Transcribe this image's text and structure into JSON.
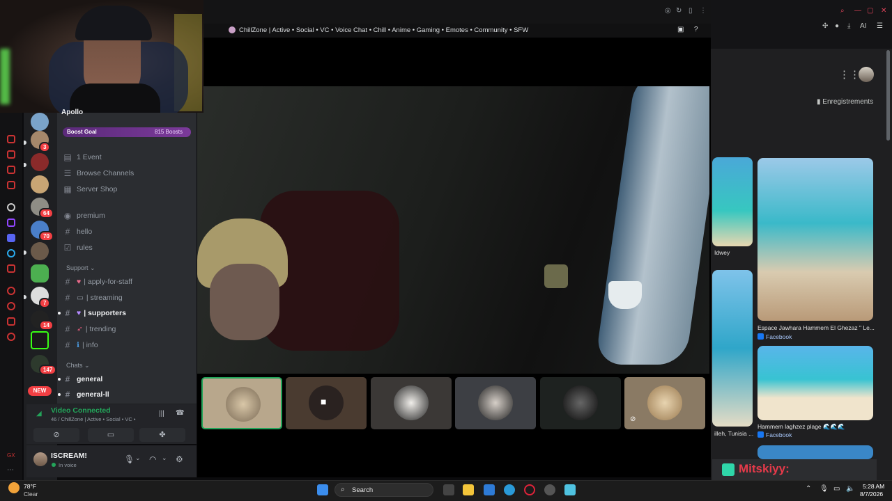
{
  "discord": {
    "boost_goal": {
      "label": "Boost Goal",
      "count": "815 Boosts"
    },
    "server_badges": [
      "3",
      "64",
      "70",
      "7",
      "14",
      "147"
    ],
    "new_badge": "NEW",
    "server_title_partial": "Apollo",
    "channels": {
      "event": "1 Event",
      "browse": "Browse Channels",
      "shop": "Server Shop",
      "premium": "premium",
      "hello": "hello",
      "rules": "rules",
      "support_category": "Support",
      "apply": "| apply-for-staff",
      "streaming": "| streaming",
      "supporters": "| supporters",
      "trending": "| trending",
      "info": "| info",
      "chats_category": "Chats",
      "general": "general",
      "general2": "general-ll"
    },
    "voice": {
      "status": "Video Connected",
      "channel": "46 / ChillZone | Active • Social • VC •"
    },
    "user": {
      "name": "ISCREAM!",
      "status": "In voice"
    },
    "call_title": "ChillZone | Active • Social • VC • Voice Chat • Chill • Anime • Gaming • Emotes • Community • SFW"
  },
  "right_page": {
    "saves_label": "Enregistrements",
    "cards": [
      {
        "title": "Idwey",
        "source": ""
      },
      {
        "title": "Espace Jawhara Hammem El Ghezaz \" Le...",
        "source": "Facebook"
      },
      {
        "title": "illeh, Tunisia ...",
        "source": ""
      },
      {
        "title": "Hammem laghzez plage 🌊🌊🌊",
        "source": "Facebook"
      }
    ],
    "overlay_name": "Mitskiyy:"
  },
  "taskbar": {
    "temp": "78°F",
    "condition": "Clear",
    "search_label": "Search",
    "time": "5:28 AM",
    "date": "8/7/2026"
  },
  "colors": {
    "discord_green": "#23a55a",
    "discord_red": "#f23f43",
    "boost_purple": "#7b3a9a"
  }
}
